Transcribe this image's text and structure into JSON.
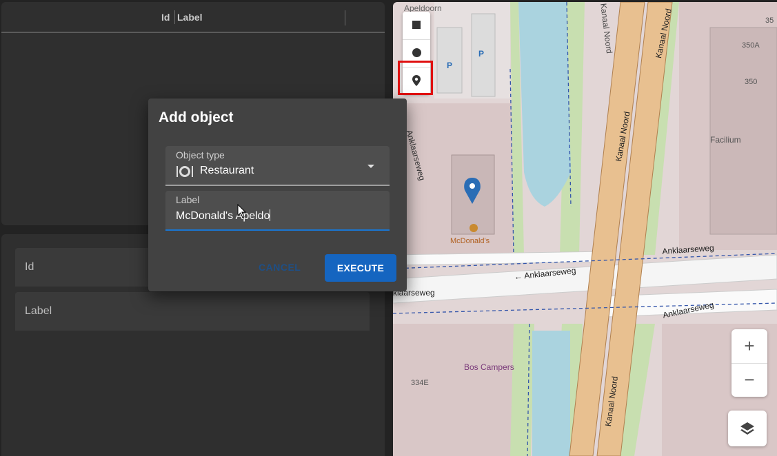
{
  "table": {
    "col_id": "Id",
    "col_label": "Label"
  },
  "form": {
    "id_label": "Id",
    "label_label": "Label"
  },
  "dialog": {
    "title": "Add object",
    "object_type_label": "Object type",
    "object_type_value": "Restaurant",
    "label_field_label": "Label",
    "label_field_value": "McDonald's Apeldo",
    "cancel_label": "CANCEL",
    "execute_label": "EXECUTE"
  },
  "map": {
    "labels": {
      "apeldoorn": "Apeldoorn",
      "kanaal_noord_1": "Kanaal Noord",
      "kanaal_noord_2": "Kanaal Noord",
      "kanaal_noord_3": "Kanaal Noord",
      "kanaal_noord_4": "Kanaal Noord",
      "anklaarseweg_1": "Anklaarseweg",
      "anklaarseweg_2": "← Anklaarseweg",
      "anklaarseweg_3": "Anklaarseweg",
      "anklaarseweg_4": "klaarseweg",
      "anklaarseweg_5": "Anklaarseweg",
      "mcdonalds": "McDonald's",
      "facilium": "Facilium",
      "bos_campers": "Bos Campers",
      "n350a": "350A",
      "n350": "350",
      "n35": "35",
      "n334e": "334E",
      "parking_1": "P",
      "parking_2": "P"
    },
    "zoom_in": "+",
    "zoom_out": "−",
    "colors": {
      "road_major": "#e8c090",
      "water": "#aad3df",
      "green": "#c8dfb0",
      "residential": "#d9c7c7",
      "marker": "#2a6db5"
    }
  },
  "icons": {
    "square": "square-icon",
    "circle": "circle-icon",
    "pin": "map-pin-icon",
    "restaurant": "restaurant-icon",
    "layers": "layers-icon",
    "dropdown": "chevron-down-icon"
  }
}
